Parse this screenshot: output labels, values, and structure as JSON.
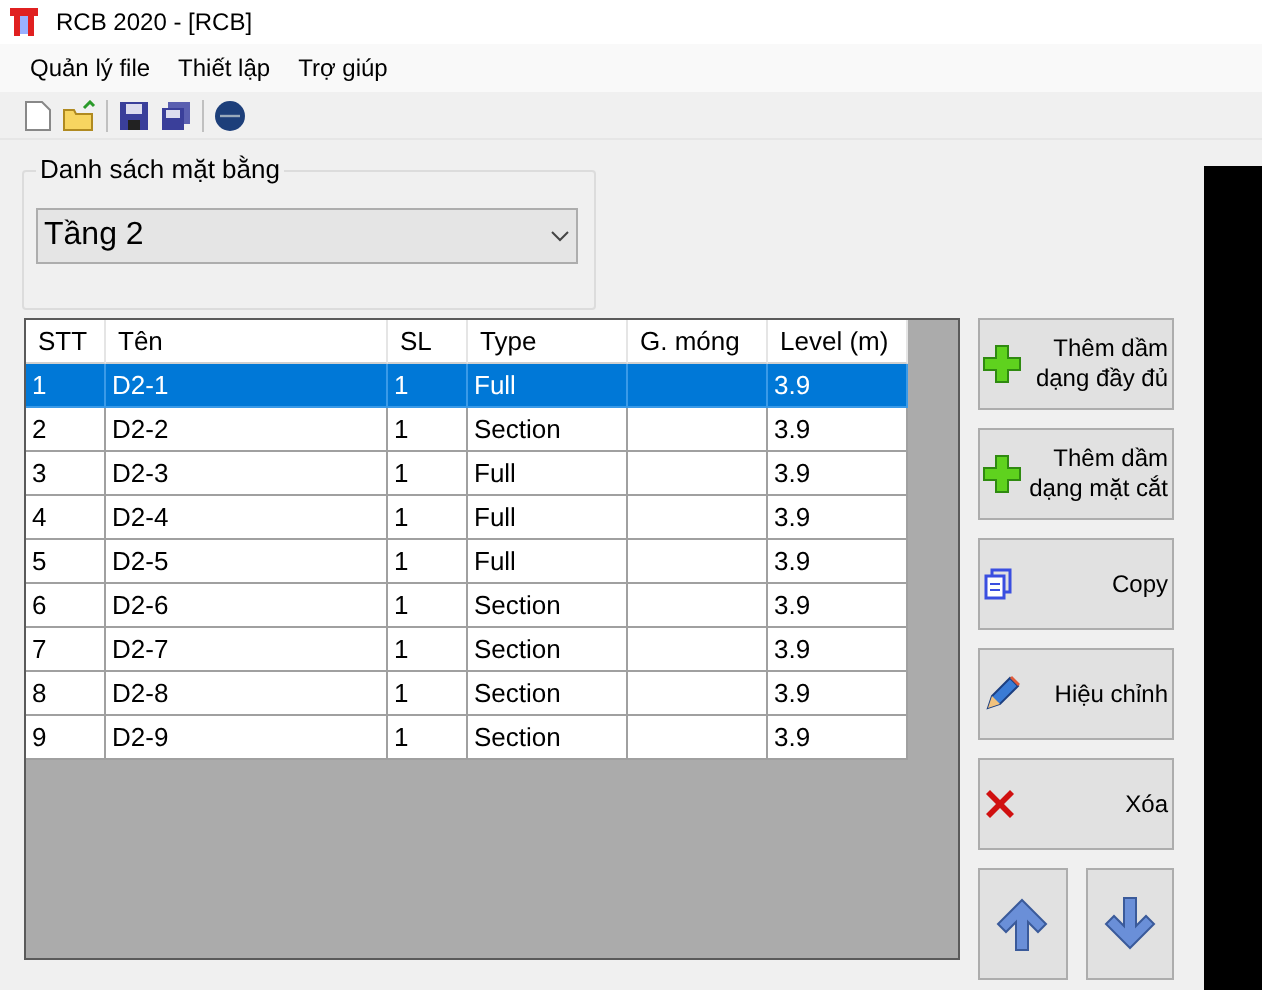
{
  "window": {
    "title": "RCB 2020 - [RCB]"
  },
  "menu": [
    "Quản lý file",
    "Thiết lập",
    "Trợ giúp"
  ],
  "floor_group": {
    "label": "Danh sách mặt bằng",
    "value": "Tầng 2"
  },
  "table": {
    "columns": [
      "STT",
      "Tên",
      "SL",
      "Type",
      "G. móng",
      "Level (m)"
    ],
    "rows": [
      {
        "cells": [
          "1",
          "D2-1",
          "1",
          "Full",
          "",
          "3.9"
        ],
        "selected": true
      },
      {
        "cells": [
          "2",
          "D2-2",
          "1",
          "Section",
          "",
          "3.9"
        ],
        "selected": false
      },
      {
        "cells": [
          "3",
          "D2-3",
          "1",
          "Full",
          "",
          "3.9"
        ],
        "selected": false
      },
      {
        "cells": [
          "4",
          "D2-4",
          "1",
          "Full",
          "",
          "3.9"
        ],
        "selected": false
      },
      {
        "cells": [
          "5",
          "D2-5",
          "1",
          "Full",
          "",
          "3.9"
        ],
        "selected": false
      },
      {
        "cells": [
          "6",
          "D2-6",
          "1",
          "Section",
          "",
          "3.9"
        ],
        "selected": false
      },
      {
        "cells": [
          "7",
          "D2-7",
          "1",
          "Section",
          "",
          "3.9"
        ],
        "selected": false
      },
      {
        "cells": [
          "8",
          "D2-8",
          "1",
          "Section",
          "",
          "3.9"
        ],
        "selected": false
      },
      {
        "cells": [
          "9",
          "D2-9",
          "1",
          "Section",
          "",
          "3.9"
        ],
        "selected": false
      }
    ]
  },
  "buttons": [
    {
      "kind": "plus",
      "label": "Thêm dầm dạng đầy đủ"
    },
    {
      "kind": "plus",
      "label": "Thêm dầm dạng mặt cắt"
    },
    {
      "kind": "copy",
      "label": "Copy"
    },
    {
      "kind": "edit",
      "label": "Hiệu chỉnh"
    },
    {
      "kind": "delete",
      "label": "Xóa"
    }
  ],
  "move_buttons": [
    {
      "kind": "up"
    },
    {
      "kind": "down"
    }
  ]
}
